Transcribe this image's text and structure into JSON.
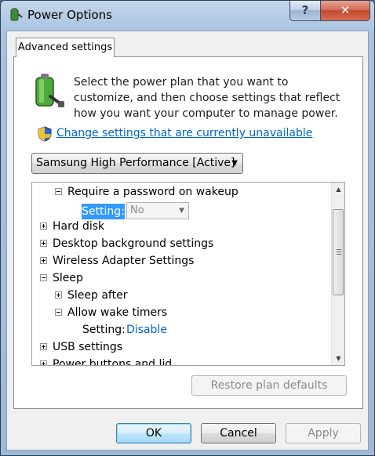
{
  "window": {
    "title": "Power Options",
    "help_label": "?",
    "close_label": "✕"
  },
  "tabs": [
    {
      "label": "Advanced settings",
      "selected": true
    }
  ],
  "description": "Select the power plan that you want to customize, and then choose settings that reflect how you want your computer to manage power.",
  "change_settings_link": "Change settings that are currently unavailable",
  "plan_select": {
    "value": "Samsung High Performance [Active]"
  },
  "tree": {
    "items": [
      {
        "label": "Require a password on wakeup",
        "expander": "minus",
        "level": 1
      },
      {
        "setting_label": "Setting:",
        "setting_value": "No",
        "level": 2,
        "highlighted": true,
        "editable": true
      },
      {
        "label": "Hard disk",
        "expander": "plus",
        "level": 0
      },
      {
        "label": "Desktop background settings",
        "expander": "plus",
        "level": 0
      },
      {
        "label": "Wireless Adapter Settings",
        "expander": "plus",
        "level": 0
      },
      {
        "label": "Sleep",
        "expander": "minus",
        "level": 0
      },
      {
        "label": "Sleep after",
        "expander": "plus",
        "level": 1
      },
      {
        "label": "Allow wake timers",
        "expander": "minus",
        "level": 1
      },
      {
        "setting_label": "Setting:",
        "setting_value": "Disable",
        "level": 2
      },
      {
        "label": "USB settings",
        "expander": "plus",
        "level": 0
      },
      {
        "label": "Power buttons and lid",
        "expander": "plus",
        "level": 0
      }
    ]
  },
  "buttons": {
    "restore": "Restore plan defaults",
    "ok": "OK",
    "cancel": "Cancel",
    "apply": "Apply"
  }
}
